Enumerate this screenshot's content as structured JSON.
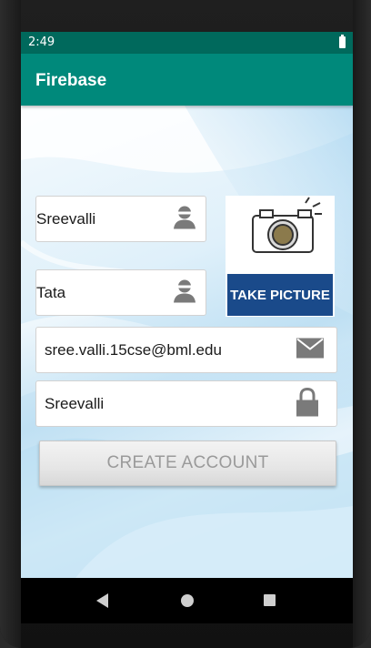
{
  "status_bar": {
    "time": "2:49",
    "battery_icon": "battery-icon"
  },
  "app_bar": {
    "title": "Firebase"
  },
  "form": {
    "first_name": {
      "value": "Sreevalli",
      "icon": "person-icon"
    },
    "last_name": {
      "value": "Tata",
      "icon": "person-icon"
    },
    "email": {
      "value": "sree.valli.15cse@bml.edu",
      "icon": "mail-icon"
    },
    "password": {
      "value": "Sreevalli",
      "icon": "lock-icon"
    },
    "take_picture_label": "TAKE PICTURE",
    "create_account_label": "CREATE ACCOUNT"
  },
  "nav": {
    "back_icon": "back-icon",
    "home_icon": "home-icon",
    "recents_icon": "recents-icon"
  },
  "colors": {
    "status_bar": "#00695c",
    "app_bar": "#00897b",
    "take_picture_banner": "#1a4a8a"
  }
}
